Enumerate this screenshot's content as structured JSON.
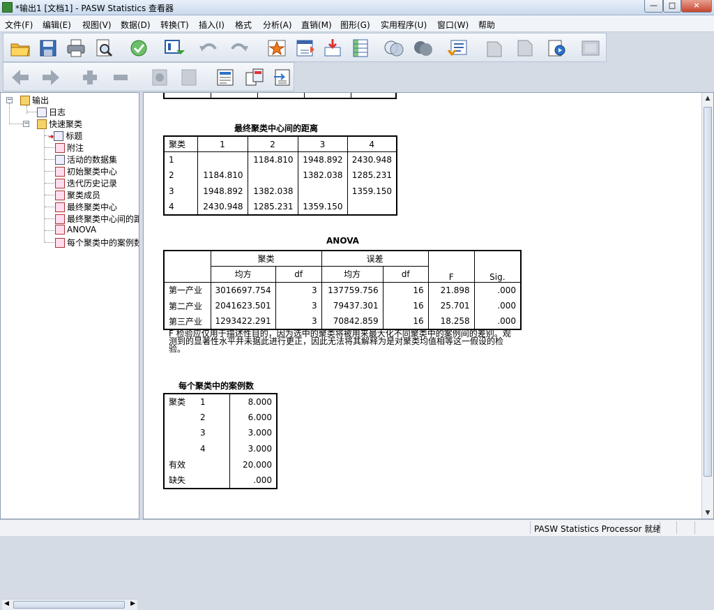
{
  "window": {
    "title": "*输出1 [文档1] - PASW Statistics 查看器",
    "min": "—",
    "max": "□",
    "close": "×"
  },
  "menu": [
    "文件(F)",
    "编辑(E)",
    "视图(V)",
    "数据(D)",
    "转换(T)",
    "插入(I)",
    "格式",
    "分析(A)",
    "直销(M)",
    "图形(G)",
    "实用程序(U)",
    "窗口(W)",
    "帮助"
  ],
  "tree": {
    "root": "输出",
    "log": "日志",
    "group": "快速聚类",
    "items": [
      "标题",
      "附注",
      "活动的数据集",
      "初始聚类中心",
      "迭代历史记录",
      "聚类成员",
      "最终聚类中心",
      "最终聚类中心间的距",
      "ANOVA",
      "每个聚类中的案例数"
    ]
  },
  "distance": {
    "title": "最终聚类中心间的距离",
    "header": [
      "聚类",
      "1",
      "2",
      "3",
      "4"
    ],
    "rows": [
      [
        "1",
        "",
        "1184.810",
        "1948.892",
        "2430.948"
      ],
      [
        "2",
        "1184.810",
        "",
        "1382.038",
        "1285.231"
      ],
      [
        "3",
        "1948.892",
        "1382.038",
        "",
        "1359.150"
      ],
      [
        "4",
        "2430.948",
        "1285.231",
        "1359.150",
        ""
      ]
    ]
  },
  "anova": {
    "title": "ANOVA",
    "group1": "聚类",
    "group2": "误差",
    "sub": [
      "均方",
      "df",
      "均方",
      "df"
    ],
    "f": "F",
    "sig": "Sig.",
    "rows": [
      [
        "第一产业",
        "3016697.754",
        "3",
        "137759.756",
        "16",
        "21.898",
        ".000"
      ],
      [
        "第二产业",
        "2041623.501",
        "3",
        "79437.301",
        "16",
        "25.701",
        ".000"
      ],
      [
        "第三产业",
        "1293422.291",
        "3",
        "70842.859",
        "16",
        "18.258",
        ".000"
      ]
    ],
    "note": "F 检验应仅用于描述性目的，因为选中的聚类将被用来最大化不同聚类中的案例间的差别。观测到的显著性水平并未据此进行更正，因此无法将其解释为是对聚类均值相等这一假设的检验。"
  },
  "cases": {
    "title": "每个聚类中的案例数",
    "label": "聚类",
    "rows": [
      [
        "1",
        "8.000"
      ],
      [
        "2",
        "6.000"
      ],
      [
        "3",
        "3.000"
      ],
      [
        "4",
        "3.000"
      ]
    ],
    "valid": "有效",
    "valid_value": "20.000",
    "missing": "缺失",
    "missing_value": ".000"
  },
  "status": {
    "processor": "PASW Statistics Processor 就绪"
  }
}
